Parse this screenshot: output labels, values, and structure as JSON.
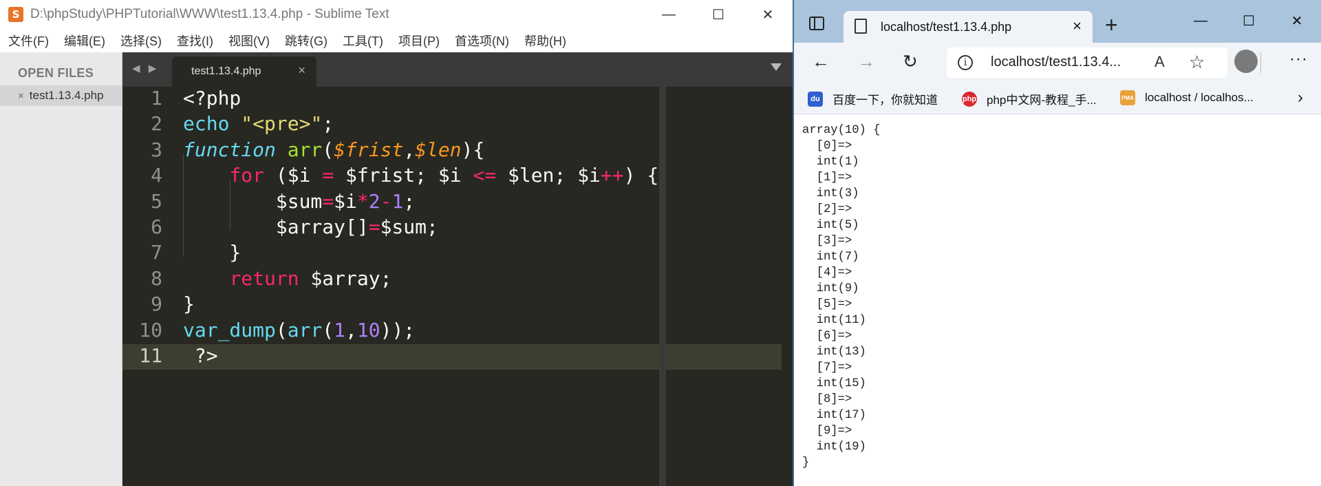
{
  "sublime": {
    "title": "D:\\phpStudy\\PHPTutorial\\WWW\\test1.13.4.php - Sublime Text",
    "logo": "S",
    "menu": [
      "文件(F)",
      "编辑(E)",
      "选择(S)",
      "查找(I)",
      "视图(V)",
      "跳转(G)",
      "工具(T)",
      "项目(P)",
      "首选项(N)",
      "帮助(H)"
    ],
    "sidebar": {
      "title": "OPEN FILES",
      "file": "test1.13.4.php",
      "close_glyph": "×"
    },
    "tab": {
      "name": "test1.13.4.php",
      "close_glyph": "×"
    },
    "nav_arrows": "◀ ▶",
    "current_line": 11,
    "lines": [
      {
        "n": "1",
        "tokens": [
          [
            "plain",
            "<?php"
          ]
        ]
      },
      {
        "n": "2",
        "tokens": [
          [
            "sup",
            "echo"
          ],
          [
            "plain",
            " "
          ],
          [
            "str",
            "\"<pre>\""
          ],
          [
            "plain",
            ";"
          ]
        ]
      },
      {
        "n": "3",
        "tokens": [
          [
            "storage",
            "function"
          ],
          [
            "plain",
            " "
          ],
          [
            "fn",
            "arr"
          ],
          [
            "plain",
            "("
          ],
          [
            "param",
            "$frist"
          ],
          [
            "plain",
            ","
          ],
          [
            "param",
            "$len"
          ],
          [
            "plain",
            "){"
          ]
        ]
      },
      {
        "n": "4",
        "tokens": [
          [
            "plain",
            "    "
          ],
          [
            "kw",
            "for"
          ],
          [
            "plain",
            " ($i "
          ],
          [
            "op",
            "="
          ],
          [
            "plain",
            " $frist; $i "
          ],
          [
            "op",
            "<="
          ],
          [
            "plain",
            " $len; $i"
          ],
          [
            "op",
            "++"
          ],
          [
            "plain",
            ") {"
          ]
        ]
      },
      {
        "n": "5",
        "tokens": [
          [
            "plain",
            "        $sum"
          ],
          [
            "op",
            "="
          ],
          [
            "plain",
            "$i"
          ],
          [
            "op",
            "*"
          ],
          [
            "num",
            "2"
          ],
          [
            "op",
            "-"
          ],
          [
            "num",
            "1"
          ],
          [
            "plain",
            ";"
          ]
        ]
      },
      {
        "n": "6",
        "tokens": [
          [
            "plain",
            "        $array[]"
          ],
          [
            "op",
            "="
          ],
          [
            "plain",
            "$sum;"
          ]
        ]
      },
      {
        "n": "7",
        "tokens": [
          [
            "plain",
            "    }"
          ]
        ]
      },
      {
        "n": "8",
        "tokens": [
          [
            "plain",
            "    "
          ],
          [
            "kw",
            "return"
          ],
          [
            "plain",
            " $array;"
          ]
        ]
      },
      {
        "n": "9",
        "tokens": [
          [
            "plain",
            "}"
          ]
        ]
      },
      {
        "n": "10",
        "tokens": [
          [
            "sup",
            "var_dump"
          ],
          [
            "plain",
            "("
          ],
          [
            "sup",
            "arr"
          ],
          [
            "plain",
            "("
          ],
          [
            "num",
            "1"
          ],
          [
            "plain",
            ","
          ],
          [
            "num",
            "10"
          ],
          [
            "plain",
            "));"
          ]
        ]
      },
      {
        "n": "11",
        "tokens": [
          [
            "plain",
            " ?>"
          ]
        ]
      }
    ]
  },
  "browser": {
    "tab_title": "localhost/test1.13.4.php",
    "tab_close": "×",
    "new_tab": "+",
    "address": "localhost/test1.13.4...",
    "bookmarks": [
      {
        "label": "百度一下，你就知道",
        "icon": "baidu-icon",
        "color": "#2f5fd0",
        "glyph": "du"
      },
      {
        "label": "php中文网-教程_手...",
        "icon": "php-cn-icon",
        "color": "#d9282f",
        "glyph": "php"
      },
      {
        "label": "localhost / localhos...",
        "icon": "phpmyadmin-icon",
        "color": "#e8a23a",
        "glyph": "PMA"
      }
    ],
    "output": "array(10) {\n  [0]=>\n  int(1)\n  [1]=>\n  int(3)\n  [2]=>\n  int(5)\n  [3]=>\n  int(7)\n  [4]=>\n  int(9)\n  [5]=>\n  int(11)\n  [6]=>\n  int(13)\n  [7]=>\n  int(15)\n  [8]=>\n  int(17)\n  [9]=>\n  int(19)\n}"
  }
}
